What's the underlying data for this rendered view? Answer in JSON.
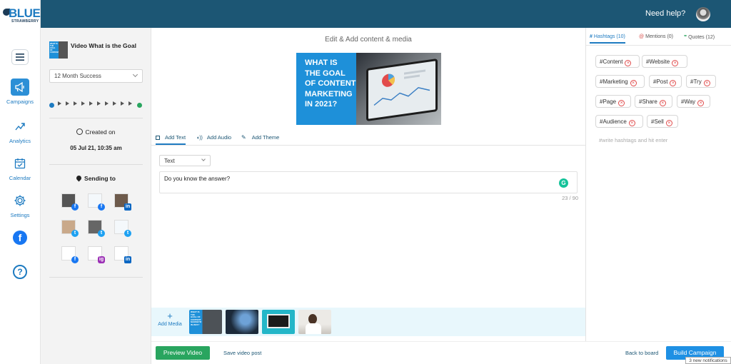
{
  "brand": {
    "name": "BLUE",
    "sub": "STRAWBERRY"
  },
  "header": {
    "help": "Need help?"
  },
  "nav": {
    "items": [
      {
        "label": "Campaigns",
        "icon": "megaphone-icon"
      },
      {
        "label": "Analytics",
        "icon": "trend-icon"
      },
      {
        "label": "Calendar",
        "icon": "calendar-icon"
      },
      {
        "label": "Settings",
        "icon": "gear-icon"
      }
    ],
    "facebook": "f",
    "help": "?"
  },
  "left": {
    "video_title": "Video What is the Goal",
    "thumb_text": "WHAT IS THE GOAL OF CONTENT",
    "success_select": "12 Month Success",
    "created_label": "Created on",
    "created_value": "05 Jul 21, 10:35 am",
    "sending_label": "Sending to",
    "badges": [
      "f",
      "f",
      "in",
      "t",
      "t",
      "t",
      "f",
      "ig",
      "in"
    ]
  },
  "center": {
    "title": "Edit & Add content & media",
    "hero_text": [
      "WHAT IS",
      "THE GOAL",
      "OF CONTENT",
      "MARKETING",
      "IN 2021?"
    ],
    "tabs": [
      "Add Text",
      "Add Audio",
      "Add Theme"
    ],
    "text_type": "Text",
    "text_value": "Do you know the answer?",
    "counter": "23 / 90",
    "add_media": "Add Media",
    "media_thumb_text": "WHAT IS THE GOAL OF CONTENT MARKETING IN 2021?"
  },
  "right": {
    "tabs": [
      "Hashtags (10)",
      "Mentions (0)",
      "Quotes (12)"
    ],
    "hashtags": [
      "#Content",
      "#Website",
      "#Marketing",
      "#Post",
      "#Try",
      "#Page",
      "#Share",
      "#Way",
      "#Audience",
      "#Sell"
    ],
    "input_placeholder": "#write hashtags and hit enter"
  },
  "footer": {
    "preview": "Preview Video",
    "save": "Save video post",
    "back": "Back to board",
    "build": "Build Campaign",
    "notifications": "3 new notifications"
  },
  "colors": {
    "topbar": "#1c5674",
    "accent": "#1e7bc1",
    "preview": "#29a55f",
    "build": "#1e90e4"
  }
}
